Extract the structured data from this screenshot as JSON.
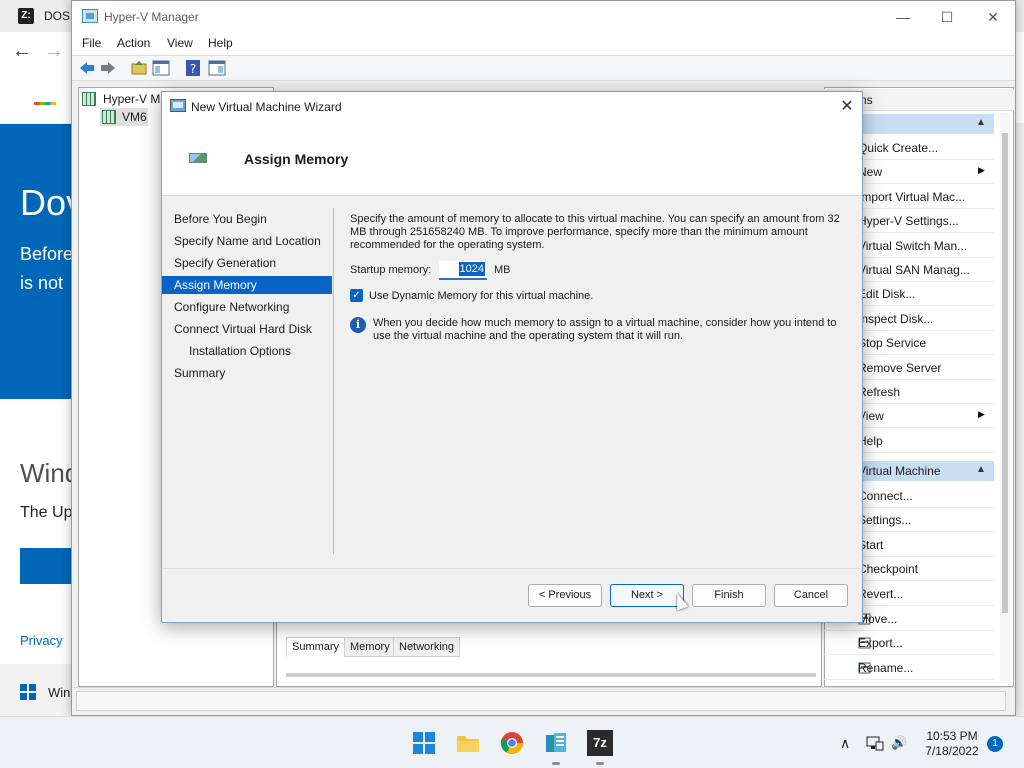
{
  "browser": {
    "tab_title": "DOSI",
    "tab_icon_text": "Z:",
    "back": "←",
    "forward": "→",
    "hero_title": "Dov",
    "hero_line1": "Before",
    "hero_line2": "is not",
    "section_title": "Wind",
    "section_text": "The Up",
    "privacy": "Privacy",
    "notif_text": "Win"
  },
  "hyperv": {
    "title": "Hyper-V Manager",
    "controls": {
      "minimize": "—",
      "maximize": "☐",
      "close": "✕"
    },
    "menu": [
      "File",
      "Action",
      "View",
      "Help"
    ],
    "tree": {
      "root": "Hyper-V M",
      "vm": "VM6"
    },
    "actions_header": "ns",
    "actions_section1": "",
    "actions_items1": [
      {
        "label": "Quick Create...",
        "sub": false
      },
      {
        "label": "New",
        "sub": true
      },
      {
        "label": "Import Virtual Mac...",
        "sub": false
      },
      {
        "label": "Hyper-V Settings...",
        "sub": false
      },
      {
        "label": "Virtual Switch Man...",
        "sub": false
      },
      {
        "label": "Virtual SAN Manag...",
        "sub": false
      },
      {
        "label": "Edit Disk...",
        "sub": false
      },
      {
        "label": "Inspect Disk...",
        "sub": false
      },
      {
        "label": "Stop Service",
        "sub": false
      },
      {
        "label": "Remove Server",
        "sub": false
      },
      {
        "label": "Refresh",
        "sub": false
      },
      {
        "label": "View",
        "sub": true
      },
      {
        "label": "Help",
        "sub": false
      }
    ],
    "actions_section2": "Virtual Machine",
    "actions_items2": [
      {
        "label": "Connect..."
      },
      {
        "label": "Settings..."
      },
      {
        "label": "Start"
      },
      {
        "label": "Checkpoint"
      },
      {
        "label": "Revert..."
      },
      {
        "label": "Move..."
      },
      {
        "label": "Export..."
      },
      {
        "label": "Rename..."
      }
    ],
    "vm_tabs": [
      "Summary",
      "Memory",
      "Networking"
    ]
  },
  "wizard": {
    "title": "New Virtual Machine Wizard",
    "close": "✕",
    "heading": "Assign Memory",
    "steps": [
      {
        "label": "Before You Begin",
        "indent": false
      },
      {
        "label": "Specify Name and Location",
        "indent": false
      },
      {
        "label": "Specify Generation",
        "indent": false
      },
      {
        "label": "Assign Memory",
        "indent": false,
        "active": true
      },
      {
        "label": "Configure Networking",
        "indent": false
      },
      {
        "label": "Connect Virtual Hard Disk",
        "indent": false
      },
      {
        "label": "Installation Options",
        "indent": true
      },
      {
        "label": "Summary",
        "indent": false
      }
    ],
    "description": "Specify the amount of memory to allocate to this virtual machine. You can specify an amount from 32 MB through 251658240 MB. To improve performance, specify more than the minimum amount recommended for the operating system.",
    "startup_memory_label": "Startup memory:",
    "startup_memory_value": "1024",
    "startup_memory_unit": "MB",
    "dynamic_memory_label": "Use Dynamic Memory for this virtual machine.",
    "dynamic_memory_checked": true,
    "info_text": "When you decide how much memory to assign to a virtual machine, consider how you intend to use the virtual machine and the operating system that it will run.",
    "buttons": {
      "previous": "< Previous",
      "next": "Next >",
      "finish": "Finish",
      "cancel": "Cancel"
    }
  },
  "taskbar": {
    "clock_time": "10:53 PM",
    "clock_date": "7/18/2022",
    "notification_count": "1",
    "app_7zip": "7z",
    "chevron": "∧",
    "speaker": "🔊"
  }
}
